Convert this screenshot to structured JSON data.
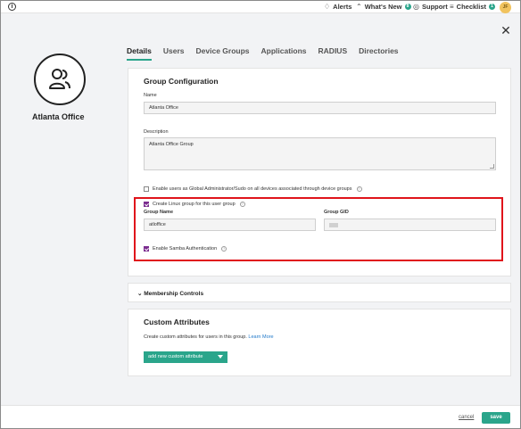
{
  "topbar": {
    "info_icon": "info-icon",
    "alerts_label": "Alerts",
    "whats_new_label": "What's New",
    "whats_new_badge": "8",
    "support_label": "Support",
    "checklist_label": "Checklist",
    "checklist_badge": "1",
    "avatar_initials": "JF",
    "colors": {
      "accent": "#2aa58b"
    }
  },
  "group": {
    "name": "Atlanta Office",
    "icon": "users-icon"
  },
  "tabs": [
    {
      "label": "Details",
      "active": true
    },
    {
      "label": "Users",
      "active": false
    },
    {
      "label": "Device Groups",
      "active": false
    },
    {
      "label": "Applications",
      "active": false
    },
    {
      "label": "RADIUS",
      "active": false
    },
    {
      "label": "Directories",
      "active": false
    }
  ],
  "config": {
    "title": "Group Configuration",
    "name_label": "Name",
    "name_value": "Atlanta Office",
    "description_label": "Description",
    "description_value": "Atlanta Office Group",
    "sudo_checkbox_label": "Enable users as Global Administrator/Sudo on all devices associated through device groups",
    "sudo_checked": false,
    "linux_checkbox_label": "Create Linux group for this user group",
    "linux_checked": true,
    "group_name_label": "Group Name",
    "group_name_value": "atloffice",
    "group_gid_label": "Group GID",
    "samba_label": "Enable Samba Authentication",
    "samba_checked": true
  },
  "highlight_color": "#e0141b",
  "membership": {
    "label": "Membership Controls"
  },
  "custom_attributes": {
    "title": "Custom Attributes",
    "description": "Create custom attributes for users in this group.",
    "learn_more": "Learn More",
    "add_button_label": "add new custom attribute"
  },
  "footer": {
    "cancel_label": "cancel",
    "save_label": "save"
  }
}
